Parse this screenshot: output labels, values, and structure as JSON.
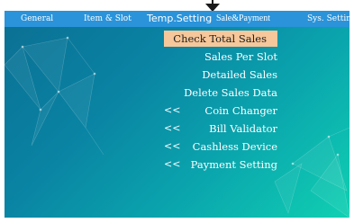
{
  "tabs": [
    {
      "label": "General"
    },
    {
      "label": "Item & Slot"
    },
    {
      "label": "Temp.Setting"
    },
    {
      "label": "Sale&Payment"
    },
    {
      "label": "Sys. Setting"
    }
  ],
  "menu": {
    "selected_index": 0,
    "items": [
      {
        "label": "Check Total Sales",
        "submenu_marker": ""
      },
      {
        "label": "Sales Per Slot",
        "submenu_marker": ""
      },
      {
        "label": "Detailed Sales",
        "submenu_marker": ""
      },
      {
        "label": "Delete Sales Data",
        "submenu_marker": ""
      },
      {
        "label": "Coin Changer",
        "submenu_marker": "<<"
      },
      {
        "label": "Bill Validator",
        "submenu_marker": "<<"
      },
      {
        "label": "Cashless Device",
        "submenu_marker": "<<"
      },
      {
        "label": "Payment Setting",
        "submenu_marker": "<<"
      }
    ]
  },
  "colors": {
    "tabbar": "#2a93da",
    "selected_bg": "#f6c79a",
    "gradient_start": "#0b6f93",
    "gradient_end": "#10d0b2"
  },
  "icons": {
    "cursor": "down-arrow-pointer-icon"
  }
}
